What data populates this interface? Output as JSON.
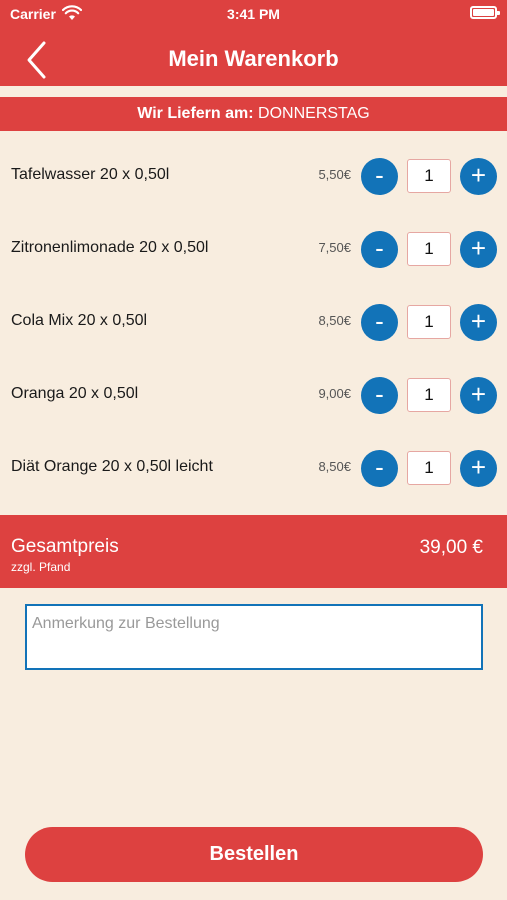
{
  "status_bar": {
    "carrier": "Carrier",
    "time": "3:41 PM"
  },
  "header": {
    "title": "Mein Warenkorb"
  },
  "delivery": {
    "label": "Wir Liefern am:",
    "day": "DONNERSTAG"
  },
  "items": [
    {
      "name": "Tafelwasser 20 x 0,50l",
      "price": "5,50€",
      "quantity": "1"
    },
    {
      "name": "Zitronenlimonade 20 x 0,50l",
      "price": "7,50€",
      "quantity": "1"
    },
    {
      "name": "Cola Mix 20 x 0,50l",
      "price": "8,50€",
      "quantity": "1"
    },
    {
      "name": "Oranga 20 x 0,50l",
      "price": "9,00€",
      "quantity": "1"
    },
    {
      "name": "Diät Orange 20 x 0,50l leicht",
      "price": "8,50€",
      "quantity": "1"
    }
  ],
  "controls": {
    "minus": "-",
    "plus": "+"
  },
  "total": {
    "label": "Gesamtpreis",
    "sublabel": "zzgl. Pfand",
    "value": "39,00 €"
  },
  "note": {
    "placeholder": "Anmerkung zur Bestellung"
  },
  "order_button": {
    "label": "Bestellen"
  },
  "colors": {
    "brand_red": "#dd4140",
    "accent_blue": "#1273b8",
    "background": "#f8eddf"
  }
}
